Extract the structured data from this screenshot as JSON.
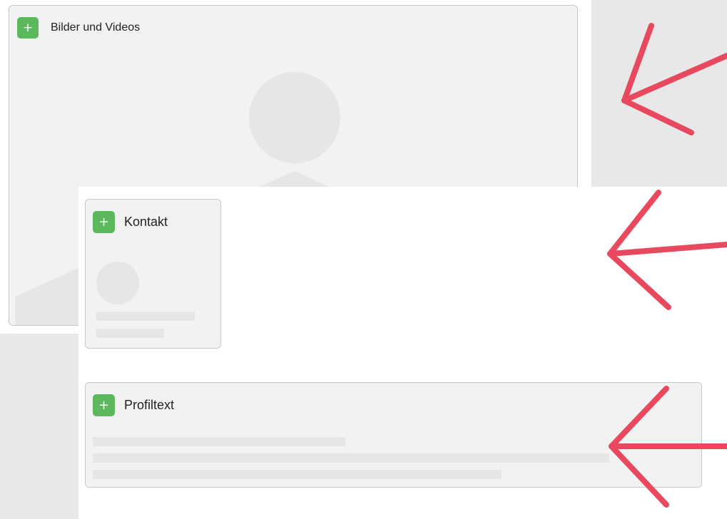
{
  "cards": {
    "media": {
      "title": "Bilder und Videos",
      "add_label": "+"
    },
    "contact": {
      "title": "Kontakt",
      "add_label": "+"
    },
    "profile": {
      "title": "Profiltext",
      "add_label": "+"
    }
  },
  "colors": {
    "add_button": "#5cb85c",
    "arrow": "#e8495f",
    "placeholder": "#e6e6e6",
    "card_bg": "#f2f2f2"
  },
  "icons": {
    "add": "plus-icon",
    "media_placeholder": "image-placeholder-icon",
    "contact_placeholder": "avatar-placeholder-icon",
    "annotation": "arrow-icon"
  }
}
